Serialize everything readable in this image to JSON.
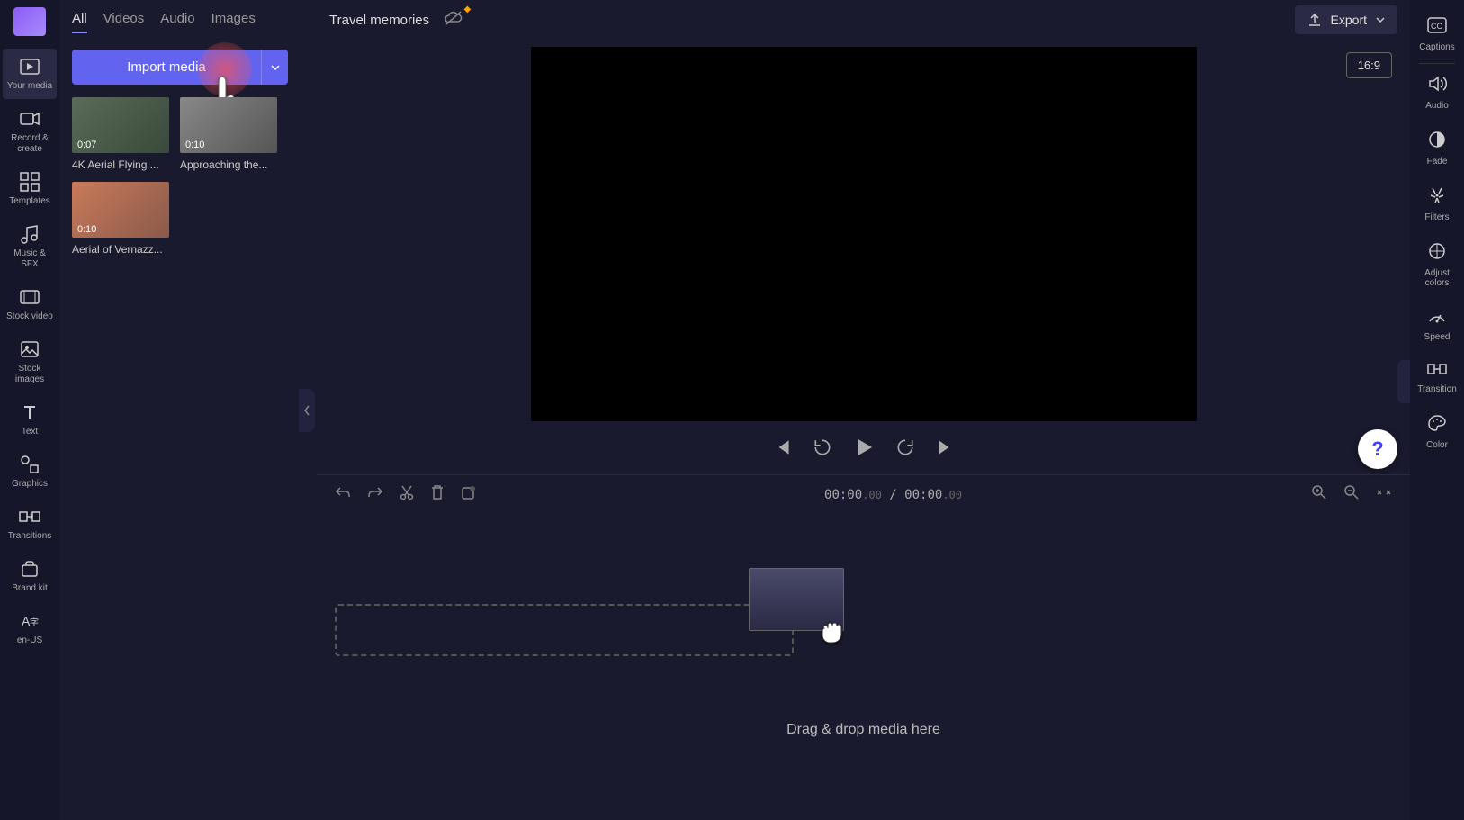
{
  "leftToolbar": {
    "items": [
      {
        "label": "Your media",
        "icon": "media"
      },
      {
        "label": "Record & create",
        "icon": "camera"
      },
      {
        "label": "Templates",
        "icon": "templates"
      },
      {
        "label": "Music & SFX",
        "icon": "music"
      },
      {
        "label": "Stock video",
        "icon": "stockvideo"
      },
      {
        "label": "Stock images",
        "icon": "stockimages"
      },
      {
        "label": "Text",
        "icon": "text"
      },
      {
        "label": "Graphics",
        "icon": "graphics"
      },
      {
        "label": "Transitions",
        "icon": "transitions"
      },
      {
        "label": "Brand kit",
        "icon": "brandkit"
      },
      {
        "label": "en-US",
        "icon": "language"
      }
    ]
  },
  "mediaPanel": {
    "tabs": [
      "All",
      "Videos",
      "Audio",
      "Images"
    ],
    "activeTab": "All",
    "importLabel": "Import media",
    "items": [
      {
        "duration": "0:07",
        "name": "4K Aerial Flying ..."
      },
      {
        "duration": "0:10",
        "name": "Approaching the..."
      },
      {
        "duration": "0:10",
        "name": "Aerial of Vernazz..."
      }
    ]
  },
  "topBar": {
    "projectTitle": "Travel memories",
    "exportLabel": "Export"
  },
  "preview": {
    "aspectRatio": "16:9"
  },
  "timeline": {
    "currentTime": "00:00",
    "currentFrac": ".00",
    "totalTime": "00:00",
    "totalFrac": ".00",
    "dropHint": "Drag & drop media here"
  },
  "rightToolbar": {
    "items": [
      {
        "label": "Captions",
        "icon": "captions"
      },
      {
        "label": "Audio",
        "icon": "audio"
      },
      {
        "label": "Fade",
        "icon": "fade"
      },
      {
        "label": "Filters",
        "icon": "filters"
      },
      {
        "label": "Adjust colors",
        "icon": "adjust"
      },
      {
        "label": "Speed",
        "icon": "speed"
      },
      {
        "label": "Transition",
        "icon": "transition"
      },
      {
        "label": "Color",
        "icon": "color"
      }
    ]
  },
  "helpFab": "?"
}
